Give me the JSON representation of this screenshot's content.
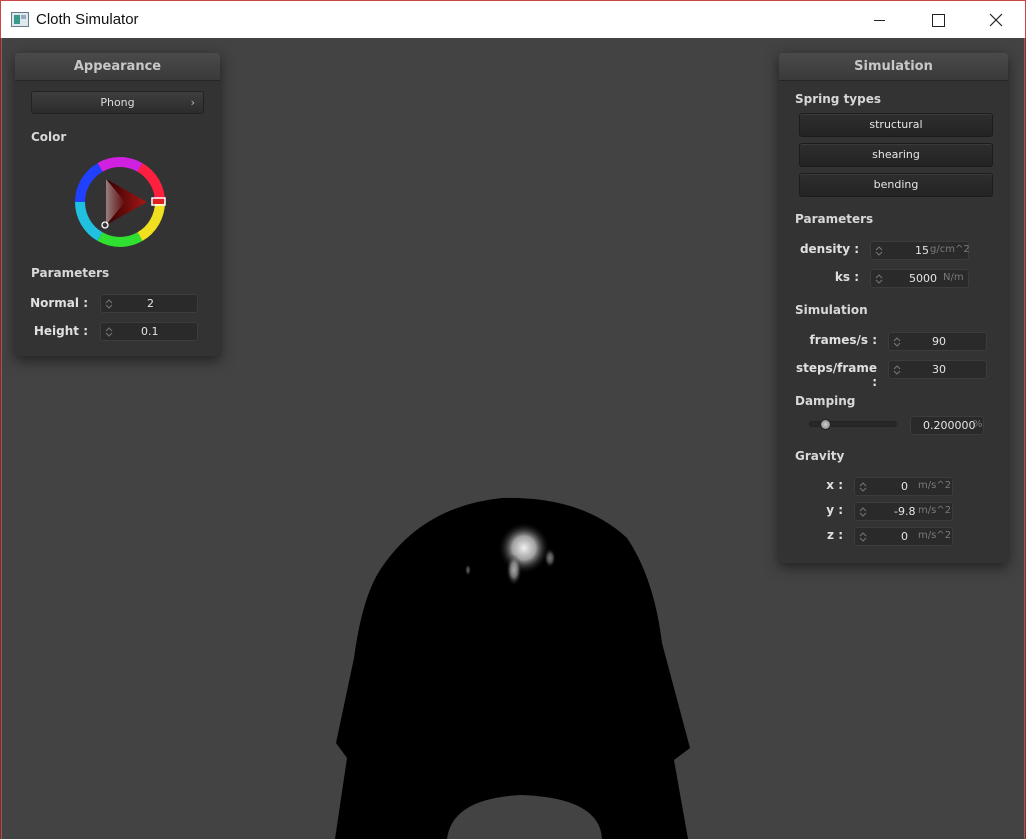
{
  "window": {
    "title": "Cloth Simulator"
  },
  "appearance": {
    "title": "Appearance",
    "shader": "Phong",
    "color_label": "Color",
    "color_value": "#e02020",
    "parameters_label": "Parameters",
    "fields": [
      {
        "label": "Normal :",
        "value": "2"
      },
      {
        "label": "Height :",
        "value": "0.1"
      }
    ]
  },
  "simulation": {
    "title": "Simulation",
    "spring_types_label": "Spring types",
    "spring_types": [
      "structural",
      "shearing",
      "bending"
    ],
    "parameters_label": "Parameters",
    "parameters": [
      {
        "label": "density :",
        "value": "15",
        "unit": "g/cm^2"
      },
      {
        "label": "ks :",
        "value": "5000",
        "unit": "N/m"
      }
    ],
    "simulation_label": "Simulation",
    "sim_fields": [
      {
        "label": "frames/s :",
        "value": "90"
      },
      {
        "label": "steps/frame :",
        "value": "30"
      }
    ],
    "damping_label": "Damping",
    "damping": {
      "value": "0.200000",
      "unit": "%",
      "slider_fraction": 0.2
    },
    "gravity_label": "Gravity",
    "gravity": [
      {
        "label": "x :",
        "value": "0",
        "unit": "m/s^2"
      },
      {
        "label": "y :",
        "value": "-9.8",
        "unit": "m/s^2"
      },
      {
        "label": "z :",
        "value": "0",
        "unit": "m/s^2"
      }
    ]
  },
  "icons": {
    "app": "app-window-icon",
    "minimize": "minimize-icon",
    "maximize": "maximize-icon",
    "close": "close-icon",
    "spinner": "spinner-arrows-icon",
    "dropdown": "chevron-right-icon"
  }
}
